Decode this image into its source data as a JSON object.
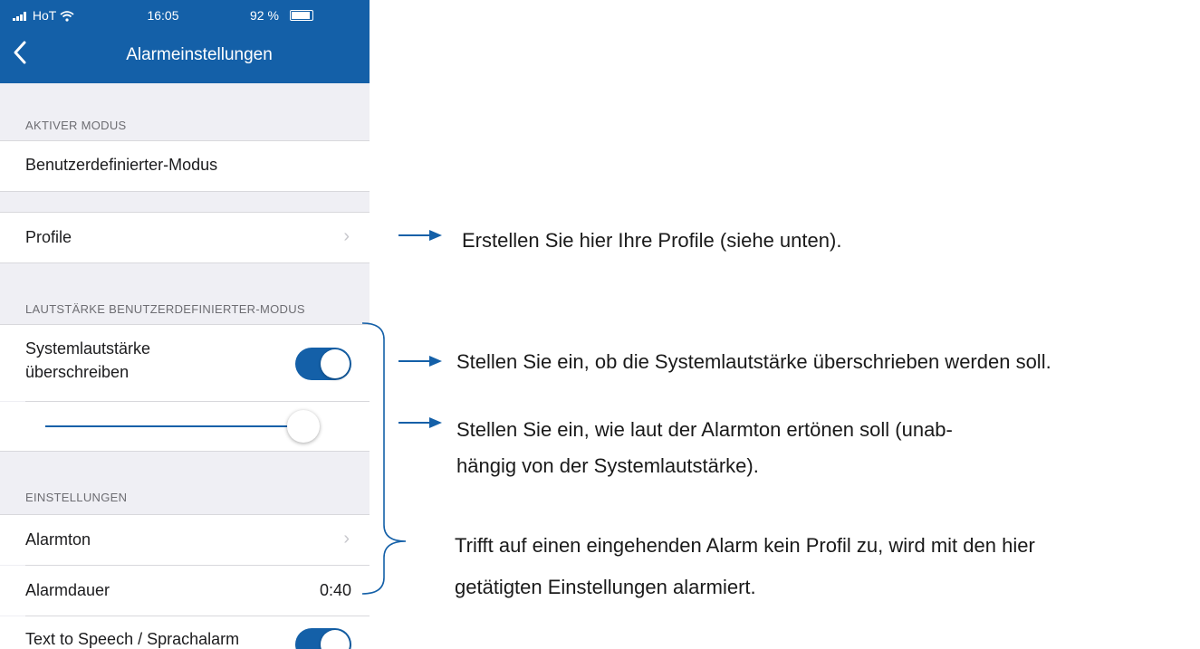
{
  "status_bar": {
    "carrier": "HoT",
    "time": "16:05",
    "battery": "92 %"
  },
  "nav": {
    "title": "Alarmeinstellungen",
    "back_icon": "chevron-left-icon"
  },
  "sections": {
    "active_mode": {
      "header": "AKTIVER MODUS",
      "value": "Benutzerdefinierter-Modus"
    },
    "profiles": {
      "label": "Profile"
    },
    "volume": {
      "header": "LAUTSTÄRKE BENUTZERDEFINIERTER-MODUS",
      "override_label_line1": "Systemlautstärke",
      "override_label_line2": "überschreiben",
      "override_on": true,
      "slider_level": 0.95
    },
    "settings": {
      "header": "EINSTELLUNGEN",
      "alarm_tone_label": "Alarmton",
      "duration_label": "Alarmdauer",
      "duration_value": "0:40",
      "tts_label": "Text to Speech / Sprachalarm",
      "tts_on": true
    }
  },
  "annotations": {
    "profiles_note": "Erstellen Sie hier Ihre Profile (siehe unten).",
    "override_note": "Stellen Sie ein, ob die Systemlautstärke überschrieben werden soll.",
    "slider_note_line1": "Stellen Sie ein, wie laut der Alarmton ertönen soll (unab-",
    "slider_note_line2": "hängig von der Systemlautstärke).",
    "default_note_line1": "Trifft auf einen eingehenden Alarm kein Profil zu, wird mit den hier",
    "default_note_line2": "getätigten Einstellungen alarmiert."
  },
  "colors": {
    "brand_blue": "#1460a8",
    "background": "#efeff4"
  }
}
